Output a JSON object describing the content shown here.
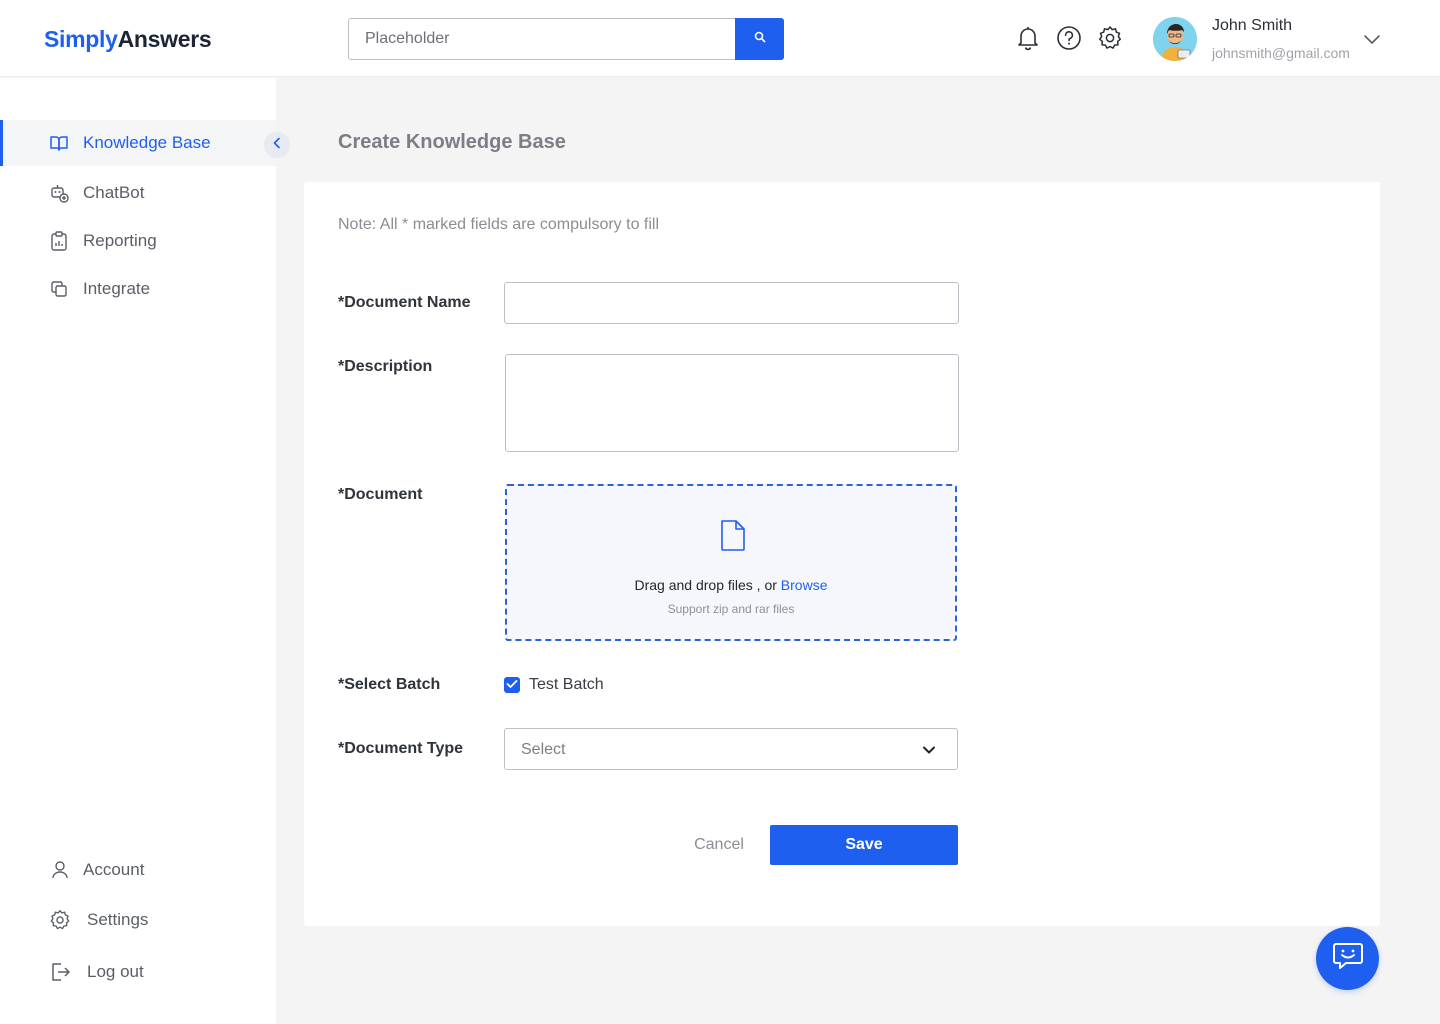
{
  "app": {
    "logo_part1": "Simply",
    "logo_part2": "Answers",
    "brand_color": "#1f5ff0"
  },
  "header": {
    "search": {
      "placeholder": "Placeholder",
      "button_icon": "search-icon"
    },
    "icons": [
      "bell-icon",
      "help-circle-icon",
      "gear-icon"
    ],
    "user": {
      "name": "John Smith",
      "email": "johnsmith@gmail.com",
      "menu_icon": "chevron-down-icon"
    }
  },
  "sidebar": {
    "items": [
      {
        "label": "Knowledge Base",
        "icon": "book-open-icon",
        "active": true
      },
      {
        "label": "ChatBot",
        "icon": "chatbot-icon",
        "active": false
      },
      {
        "label": "Reporting",
        "icon": "clipboard-chart-icon",
        "active": false
      },
      {
        "label": "Integrate",
        "icon": "layers-icon",
        "active": false
      }
    ],
    "bottom_items": [
      {
        "label": "Account",
        "icon": "user-icon"
      },
      {
        "label": "Settings",
        "icon": "gear-icon"
      },
      {
        "label": "Log out",
        "icon": "logout-icon"
      }
    ],
    "collapse_icon": "chevron-left-icon"
  },
  "main": {
    "title": "Create Knowledge Base",
    "note": "Note: All * marked fields are compulsory to fill",
    "form": {
      "document_name": {
        "label": "*Document Name",
        "value": ""
      },
      "description": {
        "label": "*Description",
        "value": ""
      },
      "document": {
        "label": "*Document",
        "drop_text": "Drag and drop files , or",
        "browse_text": "Browse",
        "support_text": "Support zip and rar files",
        "icon": "file-icon"
      },
      "select_batch": {
        "label": "*Select Batch",
        "option_label": "Test Batch",
        "checked": true
      },
      "document_type": {
        "label": "*Document Type",
        "selected": "Select"
      }
    },
    "actions": {
      "cancel_label": "Cancel",
      "save_label": "Save"
    }
  },
  "chat_widget": {
    "icon": "chat-smile-icon"
  }
}
